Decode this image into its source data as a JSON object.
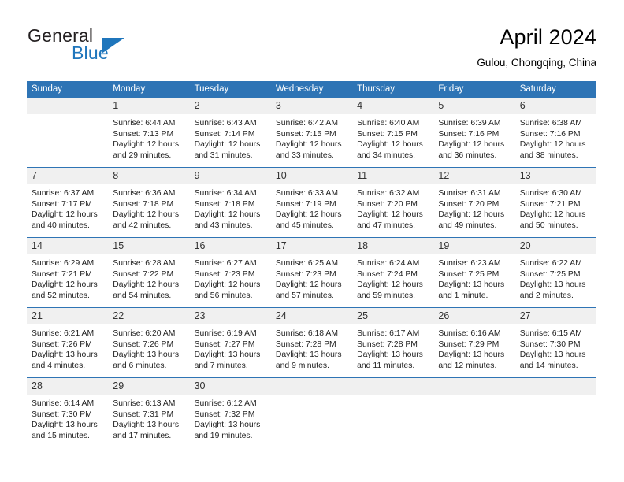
{
  "logo": {
    "word_one": "General",
    "word_two": "Blue",
    "triangle_icon": "triangle-icon",
    "accent_color": "#1f76bc"
  },
  "header": {
    "title": "April 2024",
    "subtitle": "Gulou, Chongqing, China"
  },
  "theme": {
    "header_blue": "#2e74b5",
    "daynum_gray": "#f0f0f0",
    "text": "#222222"
  },
  "calendar": {
    "weekdays": [
      "Sunday",
      "Monday",
      "Tuesday",
      "Wednesday",
      "Thursday",
      "Friday",
      "Saturday"
    ],
    "weeks": [
      [
        {
          "day": "",
          "lines": []
        },
        {
          "day": "1",
          "lines": [
            "Sunrise: 6:44 AM",
            "Sunset: 7:13 PM",
            "Daylight: 12 hours",
            "and 29 minutes."
          ]
        },
        {
          "day": "2",
          "lines": [
            "Sunrise: 6:43 AM",
            "Sunset: 7:14 PM",
            "Daylight: 12 hours",
            "and 31 minutes."
          ]
        },
        {
          "day": "3",
          "lines": [
            "Sunrise: 6:42 AM",
            "Sunset: 7:15 PM",
            "Daylight: 12 hours",
            "and 33 minutes."
          ]
        },
        {
          "day": "4",
          "lines": [
            "Sunrise: 6:40 AM",
            "Sunset: 7:15 PM",
            "Daylight: 12 hours",
            "and 34 minutes."
          ]
        },
        {
          "day": "5",
          "lines": [
            "Sunrise: 6:39 AM",
            "Sunset: 7:16 PM",
            "Daylight: 12 hours",
            "and 36 minutes."
          ]
        },
        {
          "day": "6",
          "lines": [
            "Sunrise: 6:38 AM",
            "Sunset: 7:16 PM",
            "Daylight: 12 hours",
            "and 38 minutes."
          ]
        }
      ],
      [
        {
          "day": "7",
          "lines": [
            "Sunrise: 6:37 AM",
            "Sunset: 7:17 PM",
            "Daylight: 12 hours",
            "and 40 minutes."
          ]
        },
        {
          "day": "8",
          "lines": [
            "Sunrise: 6:36 AM",
            "Sunset: 7:18 PM",
            "Daylight: 12 hours",
            "and 42 minutes."
          ]
        },
        {
          "day": "9",
          "lines": [
            "Sunrise: 6:34 AM",
            "Sunset: 7:18 PM",
            "Daylight: 12 hours",
            "and 43 minutes."
          ]
        },
        {
          "day": "10",
          "lines": [
            "Sunrise: 6:33 AM",
            "Sunset: 7:19 PM",
            "Daylight: 12 hours",
            "and 45 minutes."
          ]
        },
        {
          "day": "11",
          "lines": [
            "Sunrise: 6:32 AM",
            "Sunset: 7:20 PM",
            "Daylight: 12 hours",
            "and 47 minutes."
          ]
        },
        {
          "day": "12",
          "lines": [
            "Sunrise: 6:31 AM",
            "Sunset: 7:20 PM",
            "Daylight: 12 hours",
            "and 49 minutes."
          ]
        },
        {
          "day": "13",
          "lines": [
            "Sunrise: 6:30 AM",
            "Sunset: 7:21 PM",
            "Daylight: 12 hours",
            "and 50 minutes."
          ]
        }
      ],
      [
        {
          "day": "14",
          "lines": [
            "Sunrise: 6:29 AM",
            "Sunset: 7:21 PM",
            "Daylight: 12 hours",
            "and 52 minutes."
          ]
        },
        {
          "day": "15",
          "lines": [
            "Sunrise: 6:28 AM",
            "Sunset: 7:22 PM",
            "Daylight: 12 hours",
            "and 54 minutes."
          ]
        },
        {
          "day": "16",
          "lines": [
            "Sunrise: 6:27 AM",
            "Sunset: 7:23 PM",
            "Daylight: 12 hours",
            "and 56 minutes."
          ]
        },
        {
          "day": "17",
          "lines": [
            "Sunrise: 6:25 AM",
            "Sunset: 7:23 PM",
            "Daylight: 12 hours",
            "and 57 minutes."
          ]
        },
        {
          "day": "18",
          "lines": [
            "Sunrise: 6:24 AM",
            "Sunset: 7:24 PM",
            "Daylight: 12 hours",
            "and 59 minutes."
          ]
        },
        {
          "day": "19",
          "lines": [
            "Sunrise: 6:23 AM",
            "Sunset: 7:25 PM",
            "Daylight: 13 hours",
            "and 1 minute."
          ]
        },
        {
          "day": "20",
          "lines": [
            "Sunrise: 6:22 AM",
            "Sunset: 7:25 PM",
            "Daylight: 13 hours",
            "and 2 minutes."
          ]
        }
      ],
      [
        {
          "day": "21",
          "lines": [
            "Sunrise: 6:21 AM",
            "Sunset: 7:26 PM",
            "Daylight: 13 hours",
            "and 4 minutes."
          ]
        },
        {
          "day": "22",
          "lines": [
            "Sunrise: 6:20 AM",
            "Sunset: 7:26 PM",
            "Daylight: 13 hours",
            "and 6 minutes."
          ]
        },
        {
          "day": "23",
          "lines": [
            "Sunrise: 6:19 AM",
            "Sunset: 7:27 PM",
            "Daylight: 13 hours",
            "and 7 minutes."
          ]
        },
        {
          "day": "24",
          "lines": [
            "Sunrise: 6:18 AM",
            "Sunset: 7:28 PM",
            "Daylight: 13 hours",
            "and 9 minutes."
          ]
        },
        {
          "day": "25",
          "lines": [
            "Sunrise: 6:17 AM",
            "Sunset: 7:28 PM",
            "Daylight: 13 hours",
            "and 11 minutes."
          ]
        },
        {
          "day": "26",
          "lines": [
            "Sunrise: 6:16 AM",
            "Sunset: 7:29 PM",
            "Daylight: 13 hours",
            "and 12 minutes."
          ]
        },
        {
          "day": "27",
          "lines": [
            "Sunrise: 6:15 AM",
            "Sunset: 7:30 PM",
            "Daylight: 13 hours",
            "and 14 minutes."
          ]
        }
      ],
      [
        {
          "day": "28",
          "lines": [
            "Sunrise: 6:14 AM",
            "Sunset: 7:30 PM",
            "Daylight: 13 hours",
            "and 15 minutes."
          ]
        },
        {
          "day": "29",
          "lines": [
            "Sunrise: 6:13 AM",
            "Sunset: 7:31 PM",
            "Daylight: 13 hours",
            "and 17 minutes."
          ]
        },
        {
          "day": "30",
          "lines": [
            "Sunrise: 6:12 AM",
            "Sunset: 7:32 PM",
            "Daylight: 13 hours",
            "and 19 minutes."
          ]
        },
        {
          "day": "",
          "lines": []
        },
        {
          "day": "",
          "lines": []
        },
        {
          "day": "",
          "lines": []
        },
        {
          "day": "",
          "lines": []
        }
      ]
    ]
  }
}
